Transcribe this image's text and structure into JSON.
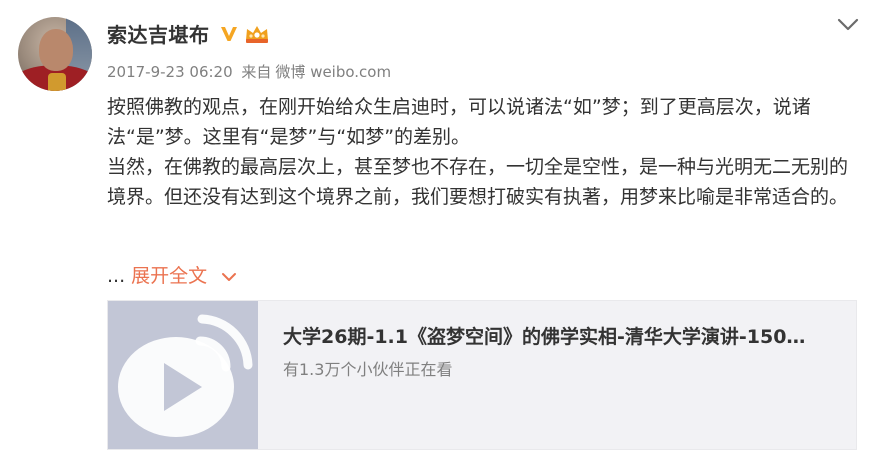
{
  "user": {
    "name": "索达吉堪布"
  },
  "meta": {
    "timestamp": "2017-9-23 06:20",
    "source_prefix": "来自",
    "source": "微博 weibo.com"
  },
  "post": {
    "paragraph1": "按照佛教的观点，在刚开始给众生启迪时，可以说诸法“如”梦；到了更高层次，说诸法“是”梦。这里有“是梦”与“如梦”的差别。",
    "paragraph2": "当然，在佛教的最高层次上，甚至梦也不存在，一切全是空性，是一种与光明无二无别的境界。但还没有达到这个境界之前，我们要想打破实有执著，用梦来比喻是非常适合的。",
    "ellipsis": "...",
    "expand_label": "展开全文"
  },
  "video_card": {
    "title": "大学26期-1.1《盗梦空间》的佛学实相-清华大学演讲-150…",
    "subtitle": "有1.3万个小伙伴正在看"
  },
  "colors": {
    "accent": "#eb7350",
    "verified": "#f5a623",
    "text": "#333333",
    "muted": "#808080"
  },
  "icons": {
    "verified": "verified-v-icon",
    "vip": "vip-crown-icon",
    "menu": "chevron-down-icon",
    "expand": "chevron-down-icon",
    "video": "weibo-video-play-icon"
  }
}
